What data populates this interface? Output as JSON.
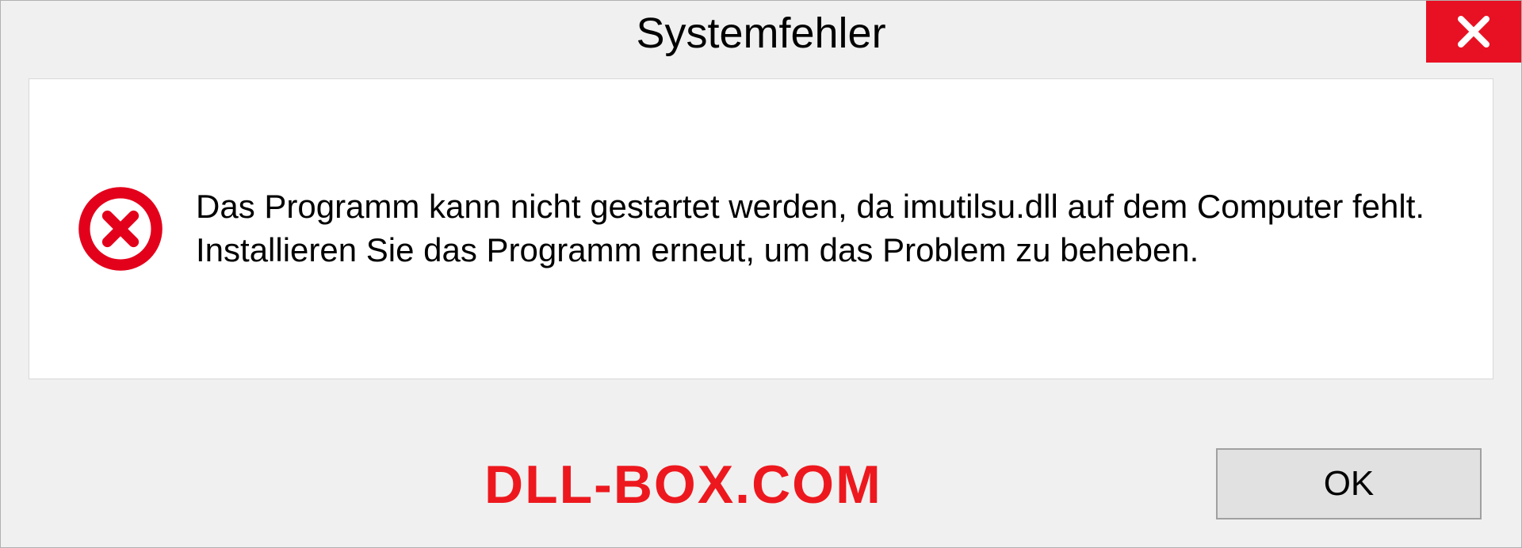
{
  "dialog": {
    "title": "Systemfehler",
    "message": "Das Programm kann nicht gestartet werden, da imutilsu.dll auf dem Computer fehlt. Installieren Sie das Programm erneut, um das Problem zu beheben.",
    "ok_label": "OK"
  },
  "watermark": "DLL-BOX.COM",
  "colors": {
    "close_bg": "#e81123",
    "error_icon": "#e3001b",
    "watermark": "#ed181e"
  }
}
